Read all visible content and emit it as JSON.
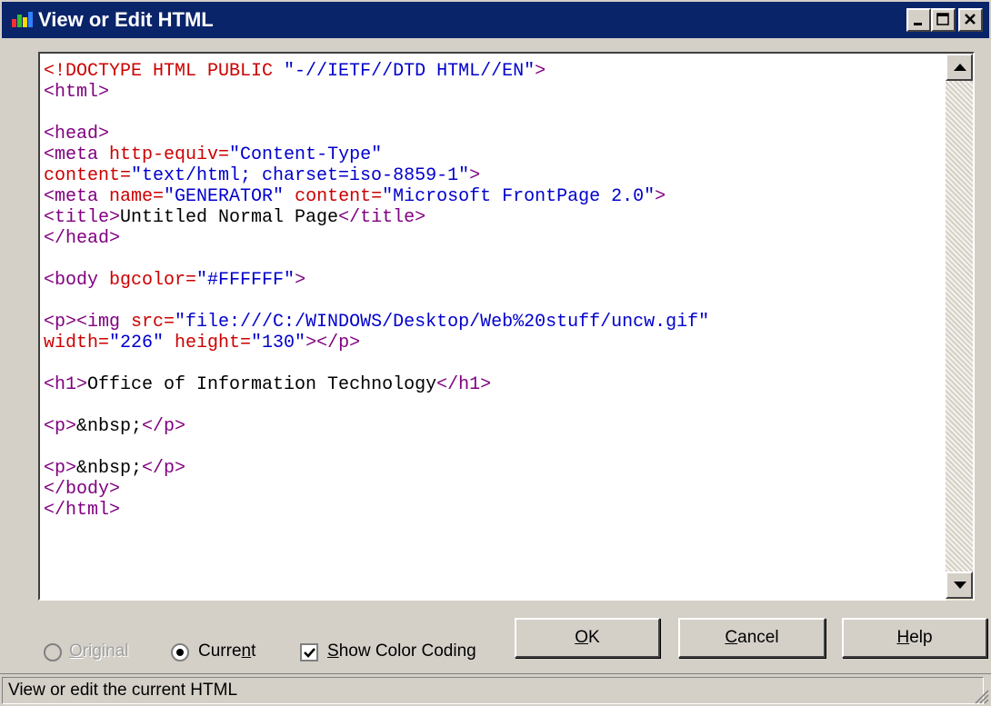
{
  "window": {
    "title": "View or Edit HTML",
    "controls": [
      "minimize-icon",
      "maximize-icon",
      "close-icon"
    ]
  },
  "editor": {
    "lines": [
      [
        {
          "t": "<!DOCTYPE HTML PUBLIC ",
          "c": "#cc0000"
        },
        {
          "t": "\"-//IETF//DTD HTML//EN\"",
          "c": "#0000cc"
        },
        {
          "t": ">",
          "c": "#800080"
        }
      ],
      [
        {
          "t": "<html>",
          "c": "#800080"
        }
      ],
      [],
      [
        {
          "t": "<head>",
          "c": "#800080"
        }
      ],
      [
        {
          "t": "<meta ",
          "c": "#800080"
        },
        {
          "t": "http-equiv=",
          "c": "#cc0000"
        },
        {
          "t": "\"Content-Type\"",
          "c": "#0000cc"
        }
      ],
      [
        {
          "t": "content=",
          "c": "#cc0000"
        },
        {
          "t": "\"text/html; charset=iso-8859-1\"",
          "c": "#0000cc"
        },
        {
          "t": ">",
          "c": "#800080"
        }
      ],
      [
        {
          "t": "<meta ",
          "c": "#800080"
        },
        {
          "t": "name=",
          "c": "#cc0000"
        },
        {
          "t": "\"GENERATOR\" ",
          "c": "#0000cc"
        },
        {
          "t": "content=",
          "c": "#cc0000"
        },
        {
          "t": "\"Microsoft FrontPage 2.0\"",
          "c": "#0000cc"
        },
        {
          "t": ">",
          "c": "#800080"
        }
      ],
      [
        {
          "t": "<title>",
          "c": "#800080"
        },
        {
          "t": "Untitled Normal Page",
          "c": "#000000"
        },
        {
          "t": "</title>",
          "c": "#800080"
        }
      ],
      [
        {
          "t": "</head>",
          "c": "#800080"
        }
      ],
      [],
      [
        {
          "t": "<body ",
          "c": "#800080"
        },
        {
          "t": "bgcolor=",
          "c": "#cc0000"
        },
        {
          "t": "\"#FFFFFF\"",
          "c": "#0000cc"
        },
        {
          "t": ">",
          "c": "#800080"
        }
      ],
      [],
      [
        {
          "t": "<p><img ",
          "c": "#800080"
        },
        {
          "t": "src=",
          "c": "#cc0000"
        },
        {
          "t": "\"file:///C:/WINDOWS/Desktop/Web%20stuff/uncw.gif\"",
          "c": "#0000cc"
        }
      ],
      [
        {
          "t": "width=",
          "c": "#cc0000"
        },
        {
          "t": "\"226\" ",
          "c": "#0000cc"
        },
        {
          "t": "height=",
          "c": "#cc0000"
        },
        {
          "t": "\"130\"",
          "c": "#0000cc"
        },
        {
          "t": "></p>",
          "c": "#800080"
        }
      ],
      [],
      [
        {
          "t": "<h1>",
          "c": "#800080"
        },
        {
          "t": "Office of Information Technology",
          "c": "#000000"
        },
        {
          "t": "</h1>",
          "c": "#800080"
        }
      ],
      [],
      [
        {
          "t": "<p>",
          "c": "#800080"
        },
        {
          "t": "&nbsp;",
          "c": "#000000"
        },
        {
          "t": "</p>",
          "c": "#800080"
        }
      ],
      [],
      [
        {
          "t": "<p>",
          "c": "#800080"
        },
        {
          "t": "&nbsp;",
          "c": "#000000"
        },
        {
          "t": "</p>",
          "c": "#800080"
        }
      ],
      [
        {
          "t": "</body>",
          "c": "#800080"
        }
      ],
      [
        {
          "t": "</html>",
          "c": "#800080"
        }
      ]
    ]
  },
  "options": {
    "original": {
      "pre": "",
      "key": "O",
      "post": "riginal",
      "selected": false,
      "enabled": false
    },
    "current": {
      "pre": "Curre",
      "key": "n",
      "post": "t",
      "selected": true,
      "enabled": true
    },
    "show_color_coding": {
      "pre": "",
      "key": "S",
      "post": "how Color Coding",
      "checked": true
    }
  },
  "buttons": {
    "ok": {
      "pre": "",
      "key": "O",
      "post": "K"
    },
    "cancel": {
      "pre": "",
      "key": "C",
      "post": "ancel"
    },
    "help": {
      "pre": "",
      "key": "H",
      "post": "elp"
    }
  },
  "status": {
    "text": "View or edit the current HTML"
  }
}
